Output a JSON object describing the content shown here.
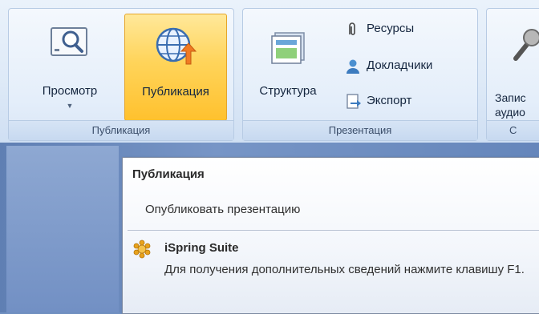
{
  "ribbon": {
    "groups": {
      "publish": {
        "label": "Публикация",
        "preview_label": "Просмотр",
        "publish_label": "Публикация"
      },
      "presentation": {
        "label": "Презентация",
        "structure_label": "Структура",
        "resources_label": "Ресурсы",
        "presenters_label": "Докладчики",
        "export_label": "Экспорт"
      },
      "record": {
        "label": "С",
        "record_label_line1": "Запис",
        "record_label_line2": "аудио"
      }
    }
  },
  "tooltip": {
    "title": "Публикация",
    "description": "Опубликовать презентацию",
    "brand": "iSpring Suite",
    "help_text": "Для получения дополнительных сведений нажмите клавишу F1."
  },
  "colors": {
    "active_button": "#ffd45a",
    "ribbon_bg": "#dde9f7",
    "workspace_bg": "#6f8fc0"
  }
}
